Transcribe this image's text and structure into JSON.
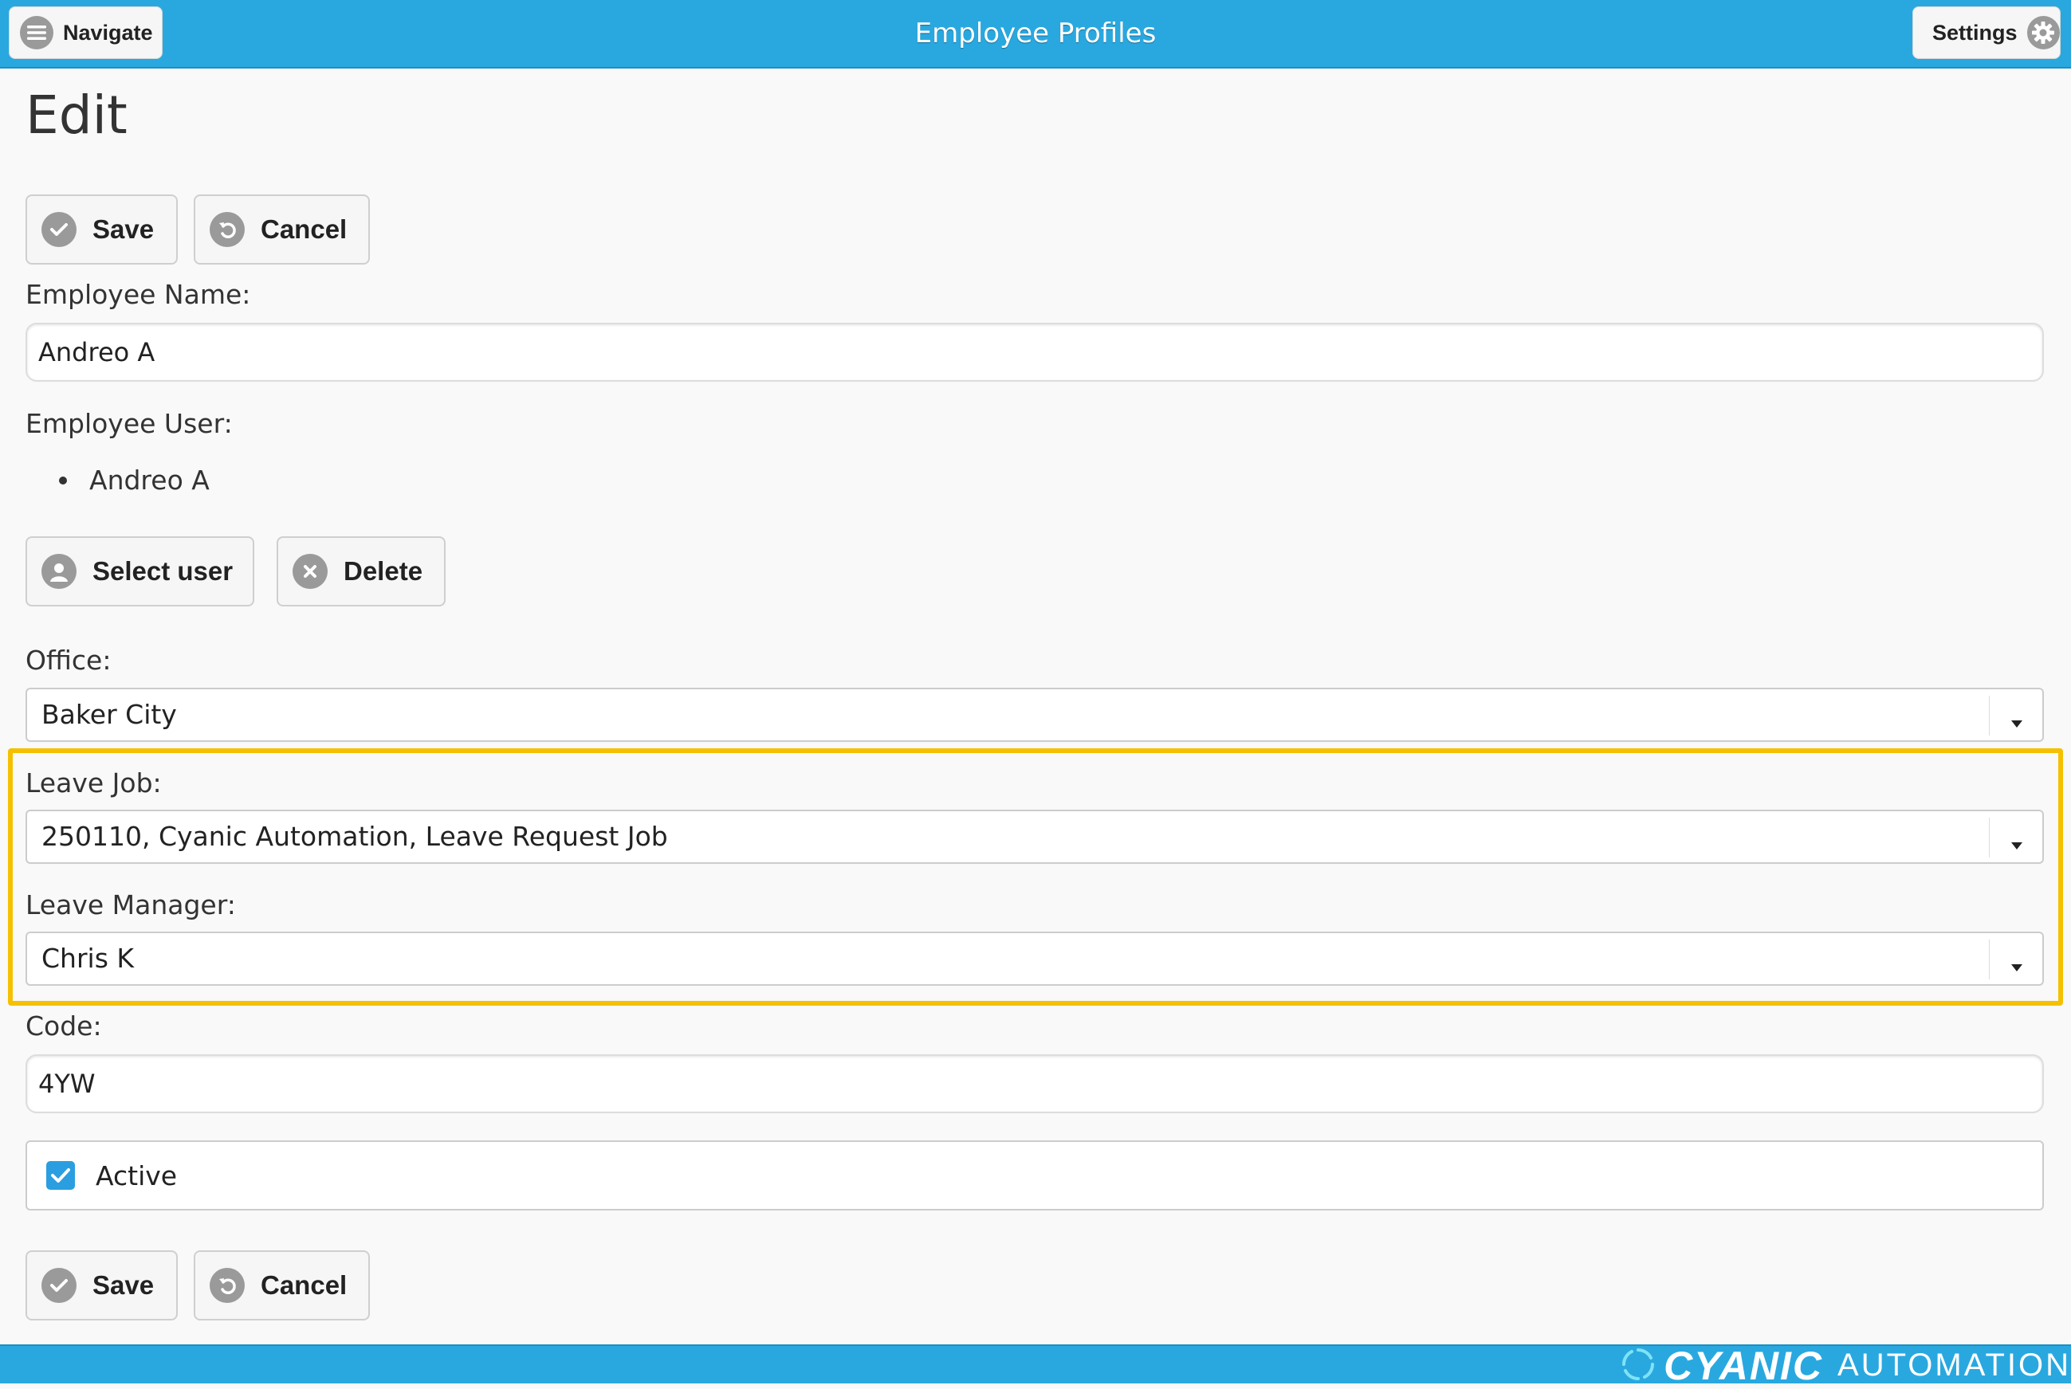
{
  "header": {
    "title": "Employee Profiles",
    "navigate_label": "Navigate",
    "settings_label": "Settings"
  },
  "page": {
    "title": "Edit"
  },
  "actions": {
    "save_label": "Save",
    "cancel_label": "Cancel"
  },
  "form": {
    "employee_name": {
      "label": "Employee Name:",
      "value": "Andreo A"
    },
    "employee_user": {
      "label": "Employee User:",
      "users": [
        "Andreo A"
      ],
      "select_user_label": "Select user",
      "delete_label": "Delete"
    },
    "office": {
      "label": "Office:",
      "value": "Baker City"
    },
    "leave_job": {
      "label": "Leave Job:",
      "value": "250110, Cyanic Automation, Leave Request Job"
    },
    "leave_manager": {
      "label": "Leave Manager:",
      "value": "Chris K"
    },
    "code": {
      "label": "Code:",
      "value": "4YW"
    },
    "active": {
      "label": "Active",
      "checked": true
    }
  },
  "footer": {
    "brand_primary": "CYANIC",
    "brand_secondary": "AUTOMATION"
  },
  "colors": {
    "header_bg": "#29a8e0",
    "highlight": "#f5c000",
    "checkbox": "#2a9ee0"
  },
  "icons": {
    "navigate": "hamburger-icon",
    "settings": "gear-icon",
    "save": "checkmark-icon",
    "cancel": "undo-icon",
    "select_user": "user-icon",
    "delete": "close-icon",
    "dropdown": "caret-down-icon"
  }
}
